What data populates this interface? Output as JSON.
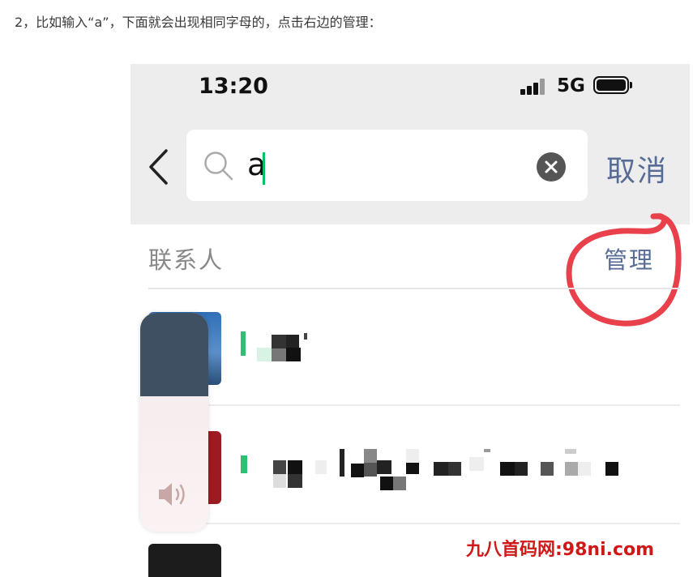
{
  "caption": "2，比如输入“a”，下面就会出现相同字母的，点击右边的管理：",
  "status_bar": {
    "time": "13:20",
    "network": "5G",
    "icons": [
      "signal-icon",
      "battery-icon"
    ]
  },
  "search": {
    "value": "a",
    "icon": "search-icon",
    "clear_icon": "clear-icon"
  },
  "nav": {
    "back_icon": "chevron-left-icon",
    "cancel_label": "取消"
  },
  "section": {
    "label": "联系人",
    "manage_label": "管理",
    "highlight_color": "#e8414b"
  },
  "contacts": [
    {
      "avatar": "avatar-blurred",
      "name": "pixelated"
    },
    {
      "avatar": "avatar-blurred",
      "name": "pixelated"
    },
    {
      "avatar": "avatar-blurred",
      "name": "pixelated"
    }
  ],
  "volume_hud": {
    "icon": "speaker-icon",
    "level": 0.62
  },
  "colors": {
    "link": "#576b95",
    "accent": "#07c160",
    "header_bg": "#ededed",
    "watermark": "#d11818"
  },
  "watermark": "九八首码网:98ni.com"
}
